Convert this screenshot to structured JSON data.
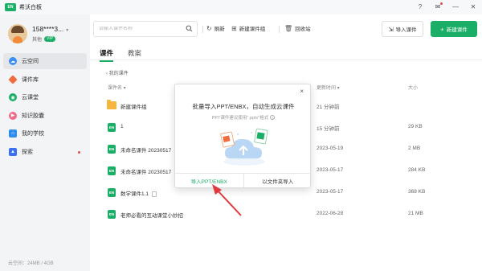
{
  "app": {
    "title": "希沃白板",
    "logo_text": "EN"
  },
  "window_controls": [
    {
      "name": "help-icon",
      "glyph": "?"
    },
    {
      "name": "message-icon",
      "glyph": "✉"
    },
    {
      "name": "minimize-icon",
      "glyph": "—"
    },
    {
      "name": "close-icon",
      "glyph": "✕"
    }
  ],
  "user": {
    "name": "158****3...",
    "group": "其他",
    "badge": "VIP"
  },
  "sidebar": {
    "items": [
      {
        "label": "云空间",
        "icon": "cloud-icon",
        "color": "#3e8ef7",
        "active": true
      },
      {
        "label": "课件库",
        "icon": "gem-icon",
        "color": "#f26d3d",
        "active": false
      },
      {
        "label": "云课堂",
        "icon": "cloud-class-icon",
        "color": "#1aae66",
        "active": false
      },
      {
        "label": "知识胶囊",
        "icon": "capsule-icon",
        "color": "#f06a8a",
        "active": false
      },
      {
        "label": "我的学校",
        "icon": "school-icon",
        "color": "#2f8cf0",
        "active": false
      },
      {
        "label": "探索",
        "icon": "rocket-icon",
        "color": "#3b6ff5",
        "active": false,
        "dot": true
      }
    ],
    "storage_text": "云空间：24MB / 4GB"
  },
  "toolbar": {
    "search_placeholder": "请输入课件名称",
    "refresh_label": "刷新",
    "new_group_label": "新建课件组",
    "recycle_label": "回收站",
    "import_label": "导入课件",
    "new_label": "新建课件"
  },
  "tabs": [
    {
      "label": "课件",
      "active": true
    },
    {
      "label": "教案",
      "active": false
    }
  ],
  "breadcrumb": "我的课件",
  "table": {
    "columns": {
      "name": "课件名",
      "time": "更新时间",
      "size": "大小"
    },
    "rows": [
      {
        "type": "folder",
        "name": "新建课件组",
        "time": "21 分钟前",
        "size": ""
      },
      {
        "type": "file",
        "name": "1",
        "time": "15 分钟前",
        "size": "29 KB"
      },
      {
        "type": "file",
        "name": "未命名课件 20230517",
        "time": "2023-05-19",
        "size": "2 MB"
      },
      {
        "type": "file",
        "name": "未命名课件 20230517",
        "time": "2023-05-17",
        "size": "284 KB"
      },
      {
        "type": "file",
        "name": "数学课件1.1",
        "time": "2023-05-17",
        "size": "368 KB",
        "tag": true
      },
      {
        "type": "file",
        "name": "老师必看的互动课堂小妙招",
        "time": "2022-06-28",
        "size": "21 MB"
      }
    ]
  },
  "modal": {
    "close_glyph": "×",
    "title": "批量导入PPT/ENBX，自动生成云课件",
    "subtitle": "PPT课件建议使用\".pptx\"格式",
    "import_button": "导入PPT/ENBX",
    "folder_button": "以文件夹导入"
  },
  "colors": {
    "accent": "#1aae66",
    "arrow": "#e0393e"
  }
}
